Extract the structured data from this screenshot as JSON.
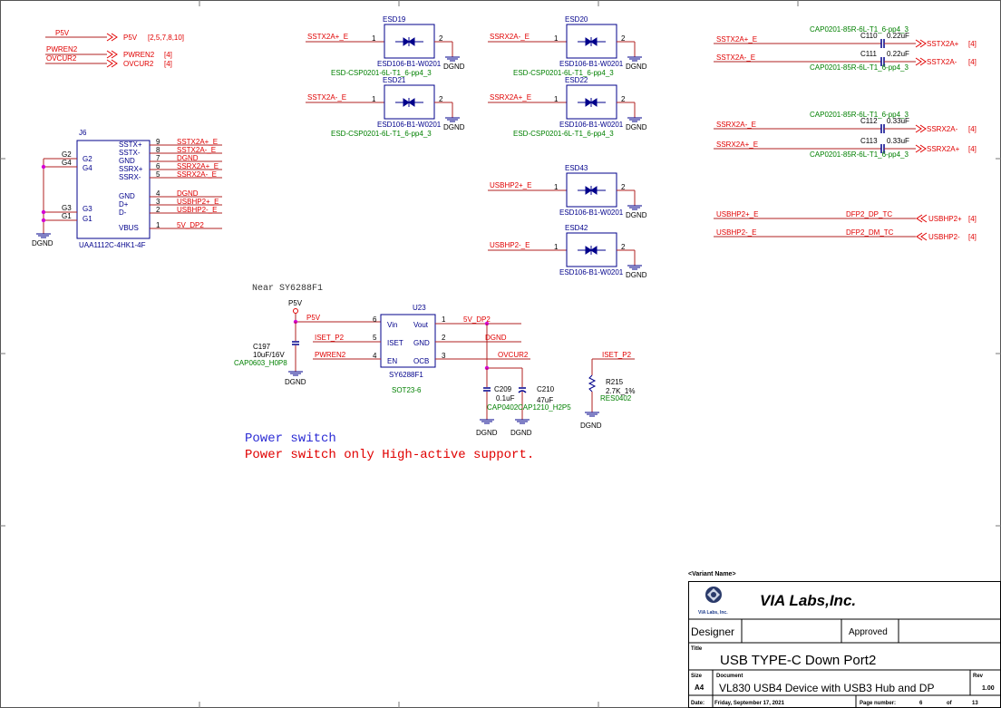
{
  "global_ports": {
    "p5v": {
      "net": "P5V",
      "label": "P5V",
      "refs": "[2,5,7,8,10]"
    },
    "pwren2": {
      "net": "PWREN2",
      "label": "PWREN2",
      "refs": "[4]"
    },
    "ovcur2": {
      "net": "OVCUR2",
      "label": "OVCUR2",
      "refs": "[4]"
    }
  },
  "connector": {
    "ref": "J6",
    "part": "UAA1112C-4HK1-4F",
    "ground": "DGND",
    "left_pins": [
      "G2",
      "G4",
      "G3",
      "G1"
    ],
    "right_pins": [
      {
        "name": "SSTX+",
        "num": "9",
        "net": "SSTX2A+_E"
      },
      {
        "name": "SSTX-",
        "num": "8",
        "net": "SSTX2A-_E"
      },
      {
        "name": "GND",
        "num": "7",
        "net": "DGND"
      },
      {
        "name": "SSRX+",
        "num": "6",
        "net": "SSRX2A+_E"
      },
      {
        "name": "SSRX-",
        "num": "5",
        "net": "SSRX2A-_E"
      },
      {
        "name": "GND",
        "num": "4",
        "net": "DGND"
      },
      {
        "name": "D+",
        "num": "3",
        "net": "USBHP2+_E"
      },
      {
        "name": "D-",
        "num": "2",
        "net": "USBHP2-_E"
      },
      {
        "name": "VBUS",
        "num": "1",
        "net": "5V_DP2"
      }
    ]
  },
  "esd": [
    {
      "ref": "ESD19",
      "net": "SSTX2A+_E",
      "part": "ESD106-B1-W0201",
      "footprint": "ESD-CSP0201-6L-T1_6-pp4_3",
      "gnd": "DGND",
      "pin1": "1",
      "pin2": "2"
    },
    {
      "ref": "ESD20",
      "net": "SSRX2A-_E",
      "part": "ESD106-B1-W0201",
      "footprint": "ESD-CSP0201-6L-T1_6-pp4_3",
      "gnd": "DGND",
      "pin1": "1",
      "pin2": "2"
    },
    {
      "ref": "ESD21",
      "net": "SSTX2A-_E",
      "part": "ESD106-B1-W0201",
      "footprint": "ESD-CSP0201-6L-T1_6-pp4_3",
      "gnd": "DGND",
      "pin1": "1",
      "pin2": "2"
    },
    {
      "ref": "ESD22",
      "net": "SSRX2A+_E",
      "part": "ESD106-B1-W0201",
      "footprint": "ESD-CSP0201-6L-T1_6-pp4_3",
      "gnd": "DGND",
      "pin1": "1",
      "pin2": "2"
    },
    {
      "ref": "ESD43",
      "net": "USBHP2+_E",
      "part": "ESD106-B1-W0201",
      "footprint": "",
      "gnd": "DGND",
      "pin1": "1",
      "pin2": "2"
    },
    {
      "ref": "ESD42",
      "net": "USBHP2-_E",
      "part": "ESD106-B1-W0201",
      "footprint": "",
      "gnd": "DGND",
      "pin1": "1",
      "pin2": "2"
    }
  ],
  "coupling": [
    {
      "left": "SSTX2A+_E",
      "ref": "C110",
      "value": "0.22uF",
      "fp": "CAP0201-85R-6L-T1_6-pp4_3",
      "port": "SSTX2A+",
      "refs": "[4]"
    },
    {
      "left": "SSTX2A-_E",
      "ref": "C111",
      "value": "0.22uF",
      "fp": "CAP0201-85R-6L-T1_6-pp4_3",
      "port": "SSTX2A-",
      "refs": "[4]"
    },
    {
      "left": "SSRX2A-_E",
      "ref": "C112",
      "value": "0.33uF",
      "fp": "CAP0201-85R-6L-T1_6-pp4_3",
      "port": "SSRX2A-",
      "refs": "[4]"
    },
    {
      "left": "SSRX2A+_E",
      "ref": "C113",
      "value": "0.33uF",
      "fp": "CAP0201-85R-6L-T1_6-pp4_3",
      "port": "SSRX2A+",
      "refs": "[4]"
    }
  ],
  "dp_links": [
    {
      "left": "USBHP2+_E",
      "mid": "DFP2_DP_TC",
      "port": "USBHP2+",
      "refs": "[4]"
    },
    {
      "left": "USBHP2-_E",
      "mid": "DFP2_DM_TC",
      "port": "USBHP2-",
      "refs": "[4]"
    }
  ],
  "power": {
    "note": "Near SY6288F1",
    "rail": "P5V",
    "u_ref": "U23",
    "u_part": "SY6288F1",
    "u_pkg": "SOT23-6",
    "pins_left": [
      {
        "name": "Vin",
        "num": "6",
        "net": "P5V"
      },
      {
        "name": "ISET",
        "num": "5",
        "net": "ISET_P2"
      },
      {
        "name": "EN",
        "num": "4",
        "net": "PWREN2"
      }
    ],
    "pins_right": [
      {
        "name": "Vout",
        "num": "1",
        "net": "5V_DP2"
      },
      {
        "name": "GND",
        "num": "2",
        "net": "DGND"
      },
      {
        "name": "OCB",
        "num": "3",
        "net": "OVCUR2"
      }
    ],
    "c197": {
      "ref": "C197",
      "value": "10uF/16V",
      "fp": "CAP0603_H0P8"
    },
    "c209": {
      "ref": "C209",
      "value": "0.1uF",
      "fp": "CAP0402"
    },
    "c210": {
      "ref": "C210",
      "value": "47uF",
      "fp": "CAP1210_H2P5"
    },
    "r215": {
      "ref": "R215",
      "value": "2.7K_1%",
      "fp": "RES0402",
      "net": "ISET_P2"
    },
    "gnd": "DGND"
  },
  "notes": {
    "line1": "Power switch",
    "line2": "Power switch only High-active support."
  },
  "title_block": {
    "variant": "<Variant Name>",
    "company": "VIA Labs,Inc.",
    "logo_text": "VIA Labs, Inc.",
    "designer_label": "Designer",
    "approved_label": "Approved",
    "title_label": "Title",
    "title": "USB TYPE-C Down Port2",
    "size_label": "Size",
    "size": "A4",
    "document_label": "Document",
    "document": "VL830 USB4 Device with USB3 Hub and DP",
    "rev_label": "Rev",
    "rev": "1.00",
    "date_label": "Date:",
    "date": "Friday, September 17, 2021",
    "page_label": "Page number:",
    "page": "6",
    "of_label": "of",
    "total": "13"
  },
  "colors": {
    "wire": "#b22222",
    "net_label": "#e00000",
    "body": "#00008b",
    "fill": "#ffffff",
    "footprint": "#008000",
    "pin_text": "#000000",
    "junction": "#d400d4",
    "note_blue": "#2b2bd4",
    "note_red": "#e00000"
  }
}
